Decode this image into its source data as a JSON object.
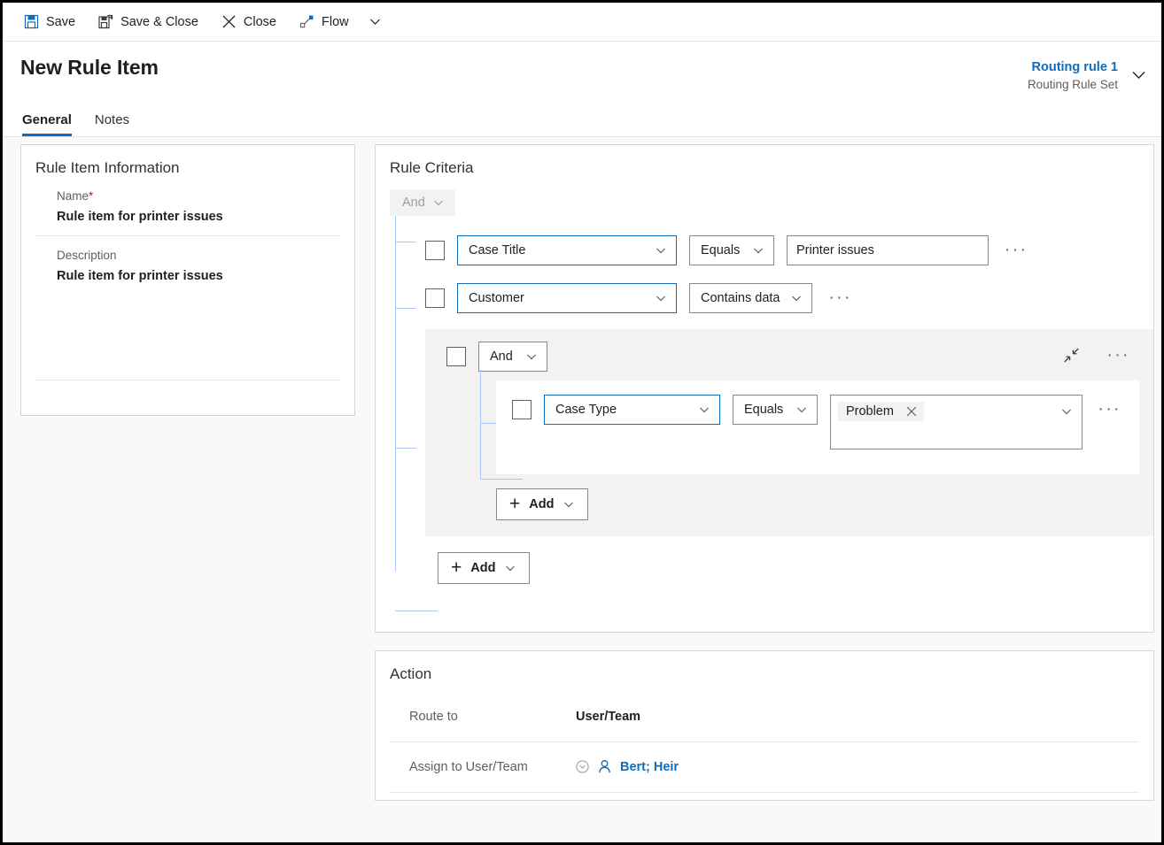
{
  "commandbar": {
    "buttons": [
      {
        "label": "Save",
        "icon": "save-icon"
      },
      {
        "label": "Save & Close",
        "icon": "save-and-close-icon"
      },
      {
        "label": "Close",
        "icon": "close-icon"
      },
      {
        "label": "Flow",
        "icon": "flow-icon"
      }
    ],
    "overflow_caret": "chevron-down-icon"
  },
  "header": {
    "title": "New Rule Item",
    "record_name": "Routing rule 1",
    "record_type": "Routing Rule Set",
    "expand_icon": "chevron-down-icon",
    "tabs": [
      {
        "label": "General",
        "selected": true
      },
      {
        "label": "Notes",
        "selected": false
      }
    ]
  },
  "rule_item_information": {
    "title": "Rule Item Information",
    "name_label": "Name",
    "name_required_marker": "*",
    "name_value": "Rule item for printer issues",
    "description_label": "Description",
    "description_value": "Rule item for printer issues"
  },
  "rule_criteria": {
    "title": "Rule Criteria",
    "root_operator": "And",
    "rows": [
      {
        "attribute": "Case Title",
        "operator": "Equals",
        "value": "Printer issues",
        "has_value_box": true,
        "more_label": "···"
      },
      {
        "attribute": "Customer",
        "operator": "Contains data",
        "value": "",
        "has_value_box": false,
        "more_label": "···"
      }
    ],
    "group": {
      "operator": "And",
      "collapse_icon": "collapse-icon",
      "more_label": "···",
      "row": {
        "attribute": "Case Type",
        "operator": "Equals",
        "value_chip": "Problem",
        "chip_remove_icon": "close-icon",
        "more_label": "···"
      },
      "add_label": "Add"
    },
    "add_label": "Add"
  },
  "action": {
    "title": "Action",
    "route_to_label": "Route to",
    "route_to_value": "User/Team",
    "assign_label": "Assign to User/Team",
    "assign_value": "Bert; Heir",
    "assign_lookup_icon": "lookup-icon",
    "assign_person_icon": "contact-icon"
  },
  "colors": {
    "accent": "#0f6cbd",
    "tree_line": "#a9c8f5",
    "required": "#a4262c",
    "panel_bg": "#faf9f8",
    "group_bg": "#f3f2f1",
    "border": "#8a8886"
  }
}
